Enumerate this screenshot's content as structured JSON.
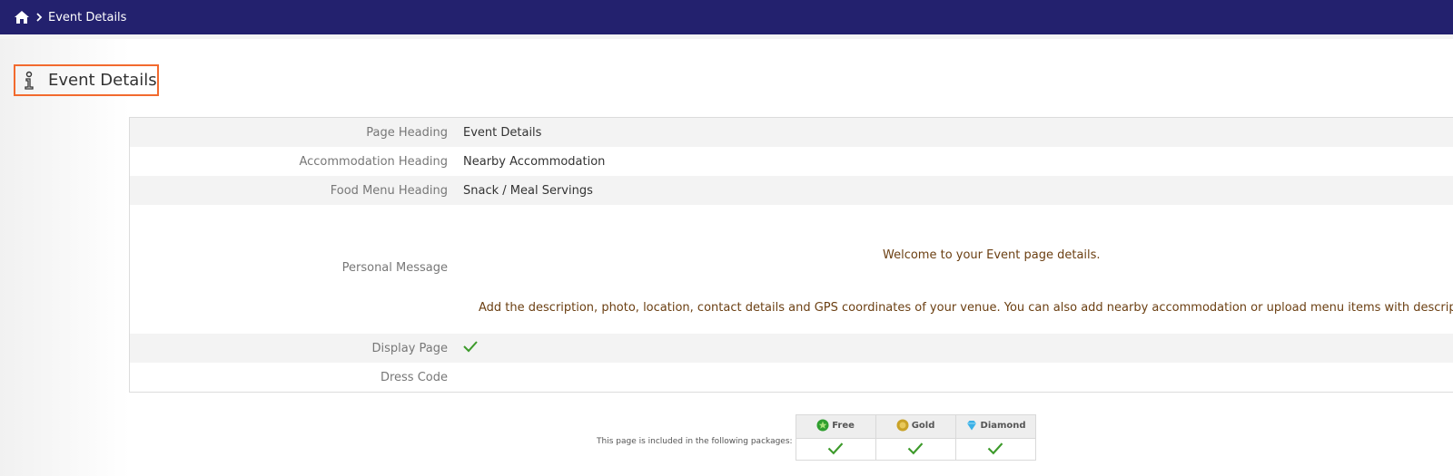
{
  "breadcrumb": {
    "home_icon": "home-icon",
    "separator_icon": "chevron-right-icon",
    "current": "Event Details"
  },
  "page_title": "Event Details",
  "rows": [
    {
      "label": "Page Heading",
      "value": "Event Details"
    },
    {
      "label": "Accommodation Heading",
      "value": "Nearby Accommodation"
    },
    {
      "label": "Food Menu Heading",
      "value": "Snack / Meal Servings"
    },
    {
      "label": "Personal Message",
      "welcome": "Welcome to your Event page details.",
      "body": "Add the description, photo, location, contact details and GPS coordinates of your venue. You can also add nearby accommodation or upload menu items with descriptions a"
    },
    {
      "label": "Display Page",
      "value": true
    },
    {
      "label": "Dress Code",
      "value": ""
    }
  ],
  "packages": {
    "label": "This page is included in the following packages:",
    "tiers": [
      {
        "name": "Free",
        "icon": "star-badge-icon",
        "color": "#2e9e2e",
        "included": true
      },
      {
        "name": "Gold",
        "icon": "gold-medal-icon",
        "color": "#c9a227",
        "included": true
      },
      {
        "name": "Diamond",
        "icon": "diamond-icon",
        "color": "#3ab0e6",
        "included": true
      }
    ]
  },
  "colors": {
    "topbar": "#23216e",
    "accent_border": "#f26a2e",
    "check": "#3c9a2a",
    "message_text": "#6b3f12"
  }
}
